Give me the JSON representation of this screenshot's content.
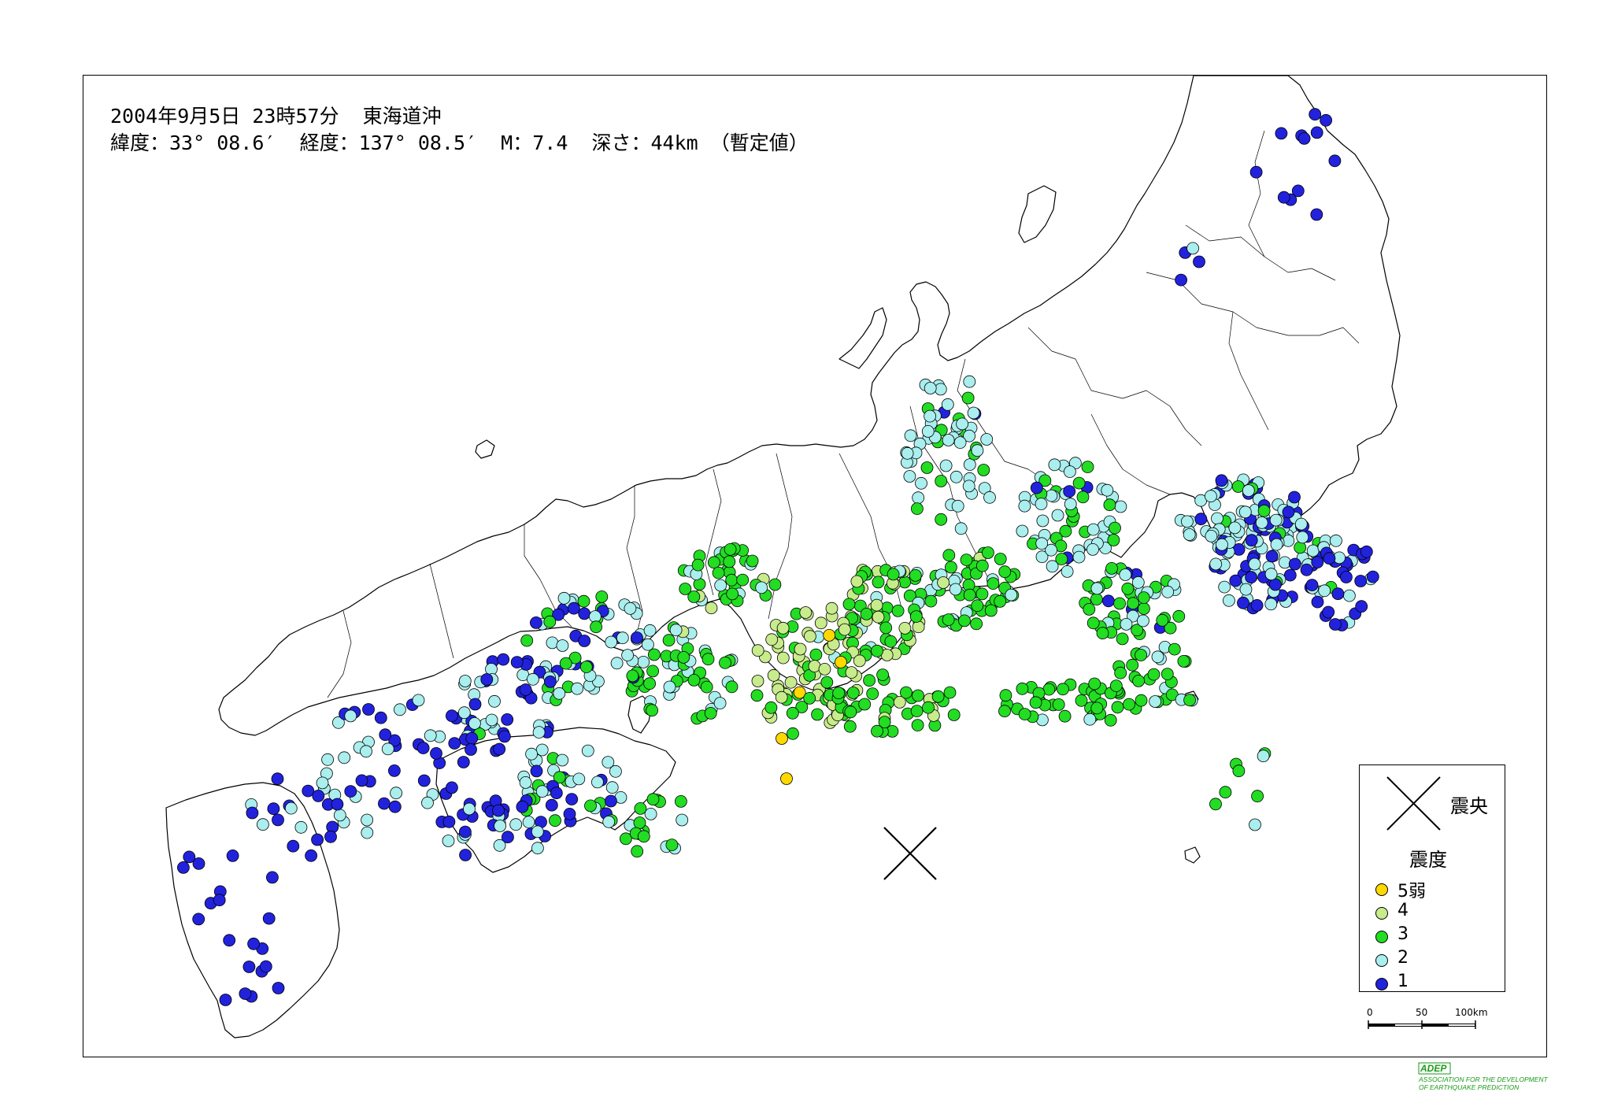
{
  "header": {
    "line1": "2004年9月5日 23時57分  東海道沖",
    "line2": "緯度：33° 08.6′  経度：137° 08.5′  M：7.4  深さ：44km （暫定値）"
  },
  "epicenter": {
    "lat": 33.143,
    "lon": 137.142,
    "marker": "cross-mark"
  },
  "legend": {
    "epicenter_label": "震央",
    "intensity_title": "震度",
    "items": [
      {
        "label": "5弱",
        "color": "#ffd800"
      },
      {
        "label": "4",
        "color": "#c8eb8c"
      },
      {
        "label": "3",
        "color": "#22dd22"
      },
      {
        "label": "2",
        "color": "#aaeeee"
      },
      {
        "label": "1",
        "color": "#2222dd"
      }
    ]
  },
  "scale_bar": {
    "ticks": [
      "0",
      "50",
      "100km"
    ]
  },
  "logo": {
    "abbr": "ADEP",
    "line1": "ASSOCIATION FOR THE DEVELOPMENT",
    "line2": "OF EARTHQUAKE PREDICTION"
  }
}
